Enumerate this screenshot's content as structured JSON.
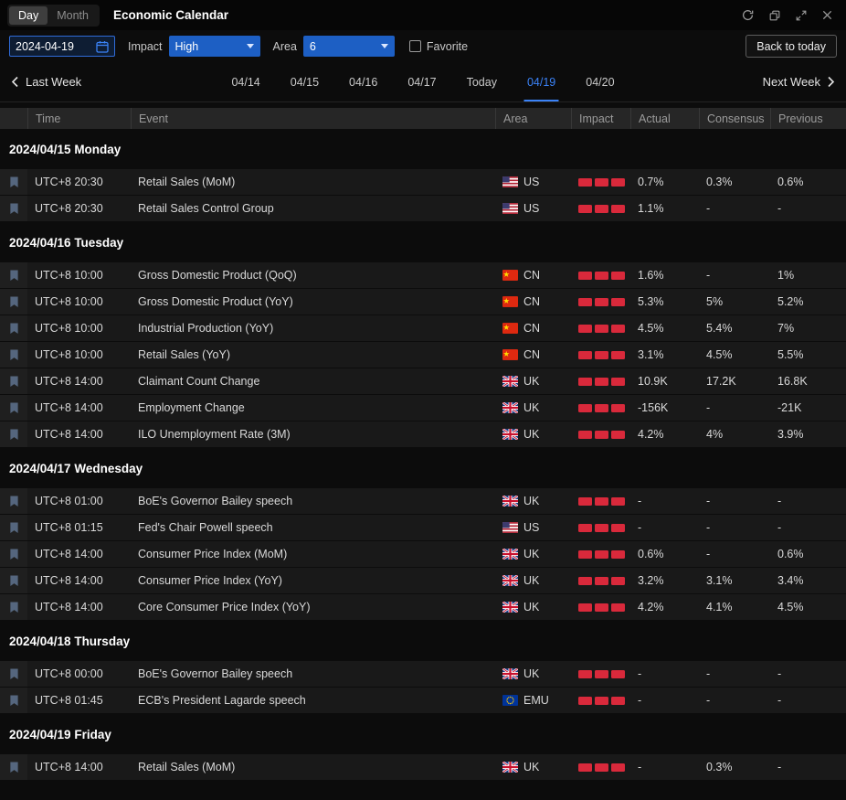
{
  "colors": {
    "accent_blue": "#3b82f6",
    "control_blue": "#1d5fc4",
    "impact_red": "#d9293b"
  },
  "titlebar": {
    "view_tabs": [
      {
        "label": "Day",
        "active": true
      },
      {
        "label": "Month",
        "active": false
      }
    ],
    "title": "Economic Calendar",
    "window_icons": [
      "refresh-icon",
      "restore-icon",
      "expand-icon",
      "close-icon"
    ]
  },
  "filters": {
    "date_value": "2024-04-19",
    "impact_label": "Impact",
    "impact_value": "High",
    "area_label": "Area",
    "area_value": "6",
    "favorite_label": "Favorite",
    "favorite_checked": false,
    "back_to_today_label": "Back to today"
  },
  "week_nav": {
    "last_week_label": "Last Week",
    "next_week_label": "Next Week",
    "days": [
      {
        "label": "04/14",
        "active": false
      },
      {
        "label": "04/15",
        "active": false
      },
      {
        "label": "04/16",
        "active": false
      },
      {
        "label": "04/17",
        "active": false
      },
      {
        "label": "Today",
        "active": false
      },
      {
        "label": "04/19",
        "active": true
      },
      {
        "label": "04/20",
        "active": false
      }
    ]
  },
  "table": {
    "headers": [
      "Time",
      "Event",
      "Area",
      "Impact",
      "Actual",
      "Consensus",
      "Previous"
    ],
    "sections": [
      {
        "date": "2024/04/15 Monday",
        "rows": [
          {
            "time": "UTC+8 20:30",
            "event": "Retail Sales (MoM)",
            "area": "US",
            "impact": 3,
            "actual": "0.7%",
            "consensus": "0.3%",
            "previous": "0.6%"
          },
          {
            "time": "UTC+8 20:30",
            "event": "Retail Sales Control Group",
            "area": "US",
            "impact": 3,
            "actual": "1.1%",
            "consensus": "-",
            "previous": "-"
          }
        ]
      },
      {
        "date": "2024/04/16 Tuesday",
        "rows": [
          {
            "time": "UTC+8 10:00",
            "event": "Gross Domestic Product (QoQ)",
            "area": "CN",
            "impact": 3,
            "actual": "1.6%",
            "consensus": "-",
            "previous": "1%"
          },
          {
            "time": "UTC+8 10:00",
            "event": "Gross Domestic Product (YoY)",
            "area": "CN",
            "impact": 3,
            "actual": "5.3%",
            "consensus": "5%",
            "previous": "5.2%"
          },
          {
            "time": "UTC+8 10:00",
            "event": "Industrial Production (YoY)",
            "area": "CN",
            "impact": 3,
            "actual": "4.5%",
            "consensus": "5.4%",
            "previous": "7%"
          },
          {
            "time": "UTC+8 10:00",
            "event": "Retail Sales (YoY)",
            "area": "CN",
            "impact": 3,
            "actual": "3.1%",
            "consensus": "4.5%",
            "previous": "5.5%"
          },
          {
            "time": "UTC+8 14:00",
            "event": "Claimant Count Change",
            "area": "UK",
            "impact": 3,
            "actual": "10.9K",
            "consensus": "17.2K",
            "previous": "16.8K"
          },
          {
            "time": "UTC+8 14:00",
            "event": "Employment Change",
            "area": "UK",
            "impact": 3,
            "actual": "-156K",
            "consensus": "-",
            "previous": "-21K"
          },
          {
            "time": "UTC+8 14:00",
            "event": "ILO Unemployment Rate (3M)",
            "area": "UK",
            "impact": 3,
            "actual": "4.2%",
            "consensus": "4%",
            "previous": "3.9%"
          }
        ]
      },
      {
        "date": "2024/04/17 Wednesday",
        "rows": [
          {
            "time": "UTC+8 01:00",
            "event": "BoE's Governor Bailey speech",
            "area": "UK",
            "impact": 3,
            "actual": "-",
            "consensus": "-",
            "previous": "-"
          },
          {
            "time": "UTC+8 01:15",
            "event": "Fed's Chair Powell speech",
            "area": "US",
            "impact": 3,
            "actual": "-",
            "consensus": "-",
            "previous": "-"
          },
          {
            "time": "UTC+8 14:00",
            "event": "Consumer Price Index (MoM)",
            "area": "UK",
            "impact": 3,
            "actual": "0.6%",
            "consensus": "-",
            "previous": "0.6%"
          },
          {
            "time": "UTC+8 14:00",
            "event": "Consumer Price Index (YoY)",
            "area": "UK",
            "impact": 3,
            "actual": "3.2%",
            "consensus": "3.1%",
            "previous": "3.4%"
          },
          {
            "time": "UTC+8 14:00",
            "event": "Core Consumer Price Index (YoY)",
            "area": "UK",
            "impact": 3,
            "actual": "4.2%",
            "consensus": "4.1%",
            "previous": "4.5%"
          }
        ]
      },
      {
        "date": "2024/04/18 Thursday",
        "rows": [
          {
            "time": "UTC+8 00:00",
            "event": "BoE's Governor Bailey speech",
            "area": "UK",
            "impact": 3,
            "actual": "-",
            "consensus": "-",
            "previous": "-"
          },
          {
            "time": "UTC+8 01:45",
            "event": "ECB's President Lagarde speech",
            "area": "EMU",
            "impact": 3,
            "actual": "-",
            "consensus": "-",
            "previous": "-"
          }
        ]
      },
      {
        "date": "2024/04/19 Friday",
        "rows": [
          {
            "time": "UTC+8 14:00",
            "event": "Retail Sales (MoM)",
            "area": "UK",
            "impact": 3,
            "actual": "-",
            "consensus": "0.3%",
            "previous": "-"
          }
        ]
      }
    ]
  }
}
